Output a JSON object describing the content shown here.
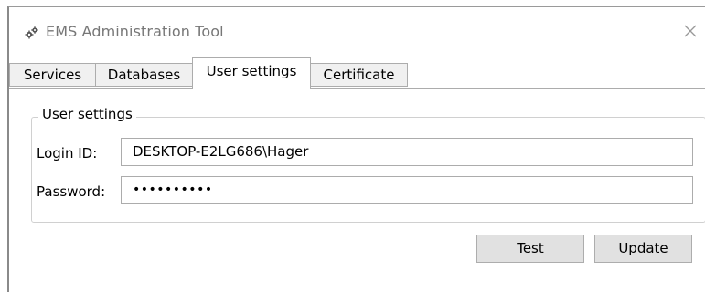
{
  "window": {
    "title": "EMS Administration Tool",
    "app_icon": "gears-icon",
    "close_icon": "close-icon"
  },
  "tabs": [
    {
      "label": "Services",
      "active": false
    },
    {
      "label": "Databases",
      "active": false
    },
    {
      "label": "User settings",
      "active": true
    },
    {
      "label": "Certificate",
      "active": false
    }
  ],
  "user_settings": {
    "group_title": "User settings",
    "login_label": "Login ID:",
    "login_value": "DESKTOP-E2LG686\\Hager",
    "password_label": "Password:",
    "password_value": "••••••••••"
  },
  "buttons": {
    "test_label": "Test",
    "update_label": "Update"
  },
  "colors": {
    "tab_inactive_bg": "#f0f0f0",
    "button_bg": "#e1e1e1",
    "border": "#acacac",
    "title_text": "#777777"
  }
}
